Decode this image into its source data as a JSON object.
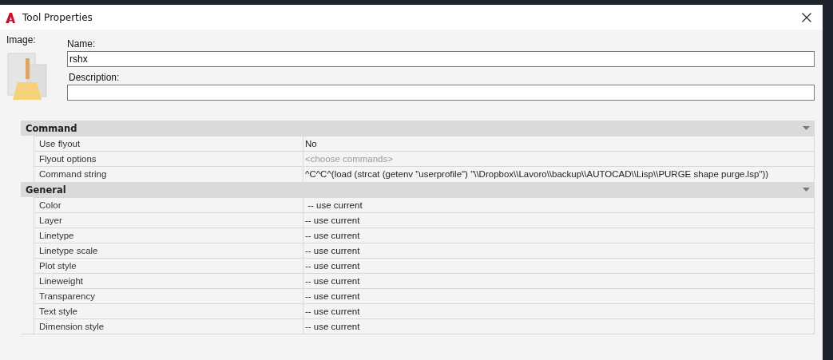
{
  "window": {
    "title": "Tool Properties"
  },
  "image_label": "Image:",
  "name": {
    "label": "Name:",
    "value": "rshx"
  },
  "description": {
    "label": "Description:"
  },
  "sections": [
    {
      "title": "Command",
      "expanded": true,
      "rows": [
        {
          "label": "Use flyout",
          "value": "No",
          "greyed": false
        },
        {
          "label": "Flyout options",
          "value": "<choose commands>",
          "greyed": true
        },
        {
          "label": "Command string",
          "value": "^C^C^(load (strcat (getenv \"userprofile\") \"\\\\Dropbox\\\\Lavoro\\\\backup\\\\AUTOCAD\\\\Lisp\\\\PURGE shape purge.lsp\"))",
          "greyed": false
        }
      ]
    },
    {
      "title": "General",
      "expanded": true,
      "rows": [
        {
          "label": "Color",
          "value": " -- use current",
          "greyed": false
        },
        {
          "label": "Layer",
          "value": "-- use current",
          "greyed": false
        },
        {
          "label": "Linetype",
          "value": "-- use current",
          "greyed": false
        },
        {
          "label": "Linetype scale",
          "value": "-- use current",
          "greyed": false
        },
        {
          "label": "Plot style",
          "value": "-- use current",
          "greyed": false
        },
        {
          "label": "Lineweight",
          "value": "-- use current",
          "greyed": false
        },
        {
          "label": "Transparency",
          "value": "-- use current",
          "greyed": false
        },
        {
          "label": "Text style",
          "value": "-- use current",
          "greyed": false
        },
        {
          "label": "Dimension  style",
          "value": "-- use current",
          "greyed": false
        }
      ]
    }
  ]
}
